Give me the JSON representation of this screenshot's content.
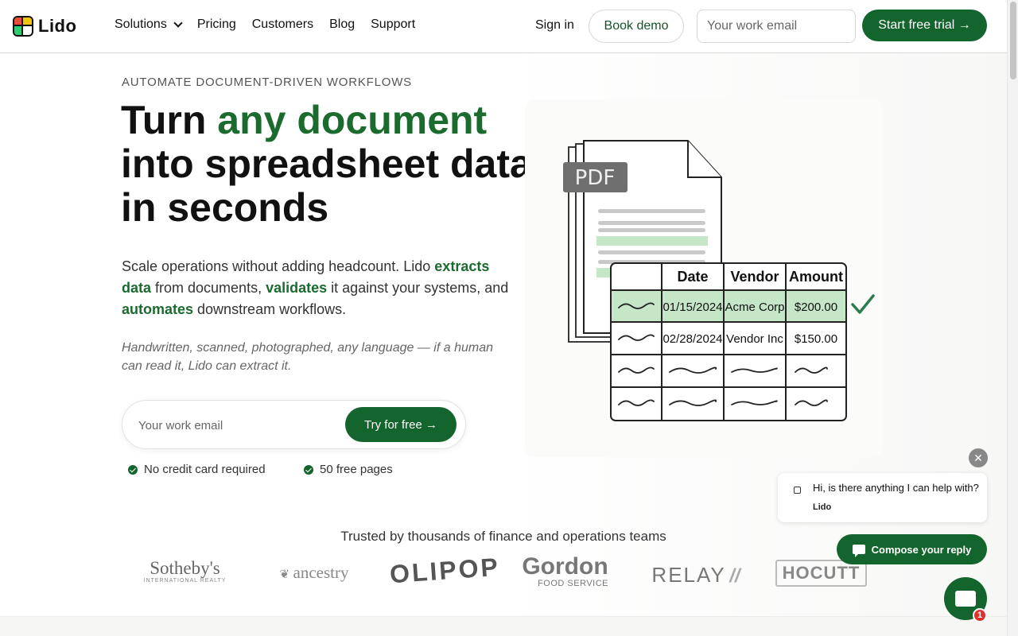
{
  "brand": {
    "name": "Lido"
  },
  "nav": {
    "items": [
      {
        "label": "Solutions",
        "has_dropdown": true
      },
      {
        "label": "Pricing"
      },
      {
        "label": "Customers"
      },
      {
        "label": "Blog"
      },
      {
        "label": "Support"
      }
    ]
  },
  "header": {
    "sign_in": "Sign in",
    "book_demo": "Book demo",
    "email_placeholder": "Your work email",
    "start_trial": "Start free trial →"
  },
  "hero": {
    "eyebrow": "AUTOMATE DOCUMENT-DRIVEN WORKFLOWS",
    "headline_pre": "Turn ",
    "headline_highlight": "any document",
    "headline_post": " into spreadsheet data in seconds",
    "sub_1": "Scale operations without adding headcount. Lido ",
    "sub_hl_1": "extracts data",
    "sub_2": " from documents, ",
    "sub_hl_2": "validates",
    "sub_3": " it against your systems, and ",
    "sub_hl_3": "automates",
    "sub_4": " downstream workflows.",
    "note": "Handwritten, scanned, photographed, any language — if a human can read it, Lido can extract it.",
    "cta_placeholder": "Your work email",
    "cta_button": "Try for free →",
    "checks": [
      "No credit card required",
      "50 free pages"
    ]
  },
  "illustration": {
    "doc_badge": "PDF",
    "table": {
      "headers": [
        "Date",
        "Vendor",
        "Amount"
      ],
      "rows": [
        [
          "01/15/2024",
          "Acme Corp",
          "$200.00"
        ],
        [
          "02/28/2024",
          "Vendor Inc",
          "$150.00"
        ]
      ]
    },
    "colors": {
      "highlight": "#c6e6c8",
      "check": "#2e7d4f",
      "accent": "#14642d"
    }
  },
  "trusted": {
    "heading": "Trusted by thousands of finance and operations teams",
    "logos": [
      {
        "name": "Sotheby's",
        "sub": "INTERNATIONAL REALTY"
      },
      {
        "name": "ancestry"
      },
      {
        "name": "OLIPOP"
      },
      {
        "name": "Gordon",
        "sub": "FOOD SERVICE"
      },
      {
        "name": "RELAY"
      },
      {
        "name": "HOCUTT"
      }
    ]
  },
  "chat": {
    "message": "Hi, is there anything I can help with?",
    "sender": "Lido",
    "compose": "Compose your reply",
    "badge_count": "1"
  }
}
